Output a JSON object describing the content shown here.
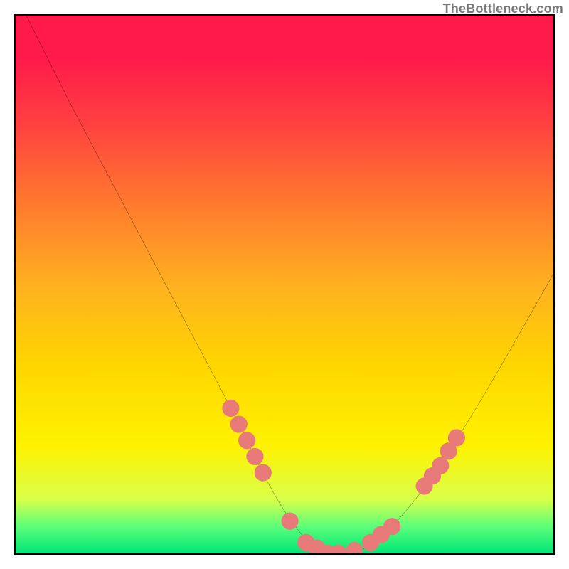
{
  "watermark": "TheBottleneck.com",
  "chart_data": {
    "type": "line",
    "title": "",
    "xlabel": "",
    "ylabel": "",
    "xlim": [
      0,
      100
    ],
    "ylim": [
      0,
      100
    ],
    "series": [
      {
        "name": "bottleneck-curve",
        "x": [
          2,
          10,
          20,
          30,
          40,
          47,
          52,
          56,
          60,
          65,
          70,
          78,
          88,
          100
        ],
        "y": [
          100,
          84,
          65,
          46,
          27,
          13,
          5,
          1,
          0,
          1,
          5,
          15,
          31,
          52
        ]
      }
    ],
    "markers": {
      "name": "highlight-markers",
      "color": "#e97a7a",
      "radius": 1.6,
      "points": [
        {
          "x": 40.0,
          "y": 27.0
        },
        {
          "x": 41.5,
          "y": 24.0
        },
        {
          "x": 43.0,
          "y": 21.0
        },
        {
          "x": 44.5,
          "y": 18.0
        },
        {
          "x": 46.0,
          "y": 15.0
        },
        {
          "x": 51.0,
          "y": 6.0
        },
        {
          "x": 54.0,
          "y": 2.0
        },
        {
          "x": 56.0,
          "y": 1.0
        },
        {
          "x": 58.0,
          "y": 0.0
        },
        {
          "x": 60.0,
          "y": 0.0
        },
        {
          "x": 63.0,
          "y": 0.5
        },
        {
          "x": 66.0,
          "y": 2.0
        },
        {
          "x": 68.0,
          "y": 3.5
        },
        {
          "x": 70.0,
          "y": 5.0
        },
        {
          "x": 76.0,
          "y": 12.5
        },
        {
          "x": 77.5,
          "y": 14.4
        },
        {
          "x": 79.0,
          "y": 16.3
        },
        {
          "x": 80.5,
          "y": 19.0
        },
        {
          "x": 82.0,
          "y": 21.5
        }
      ]
    },
    "colors": {
      "gradient_top": "#ff1a4b",
      "gradient_bottom": "#00e676",
      "curve": "#000000",
      "marker": "#e97a7a"
    }
  }
}
